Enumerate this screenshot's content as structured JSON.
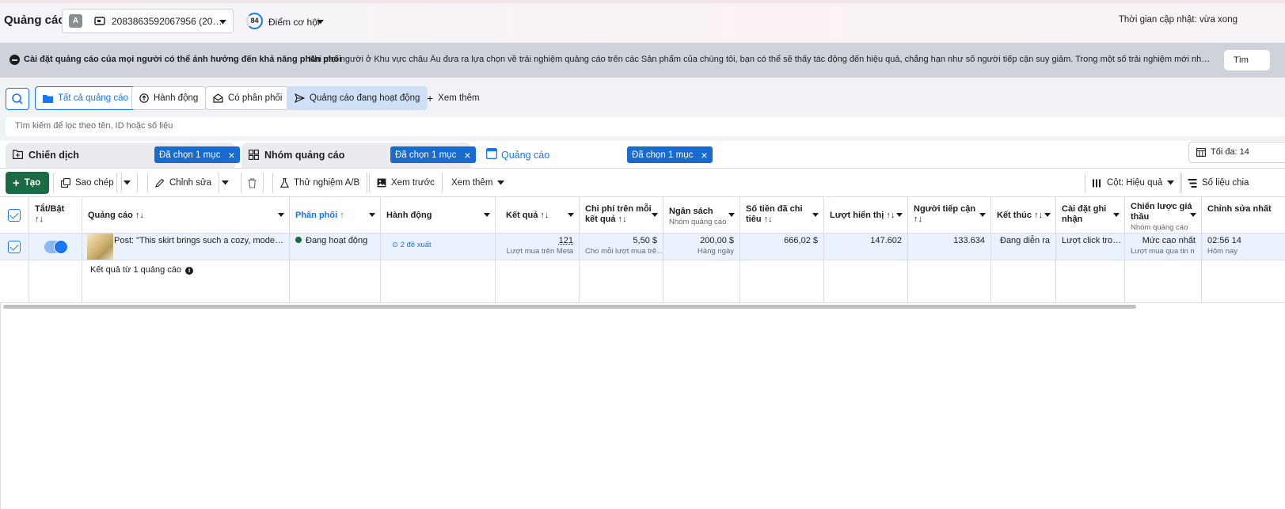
{
  "header": {
    "title": "Quảng cáo",
    "account": {
      "avatar_letter": "A",
      "id": "2083863592067956 (20…"
    },
    "opportunity": {
      "score": "84",
      "label": "Điểm cơ hội"
    },
    "update_time": "Thời gian cập nhật: vừa xong"
  },
  "notice": {
    "title": "Cài đặt quảng cáo của mọi người có thể ảnh hưởng đến khả năng phân phối",
    "text": "Khi mọi người ở Khu vực châu Âu đưa ra lựa chọn về trải nghiệm quảng cáo trên các Sản phẩm của chúng tôi, bạn có thể sẽ thấy tác động đến hiệu quả, chẳng hạn như số người tiếp cận suy giảm. Trong một số trải nghiệm mới như quảng cáo được cá nhân hóa ít hơn...",
    "button": "Tìm"
  },
  "filters": {
    "pills": [
      "Tất cả quảng cáo",
      "Hành động",
      "Có phân phối",
      "Quảng cáo đang hoạt động",
      "Xem thêm"
    ],
    "search_placeholder": "Tìm kiếm để lọc theo tên, ID hoặc số liệu"
  },
  "tabs": [
    {
      "label": "Chiến dịch",
      "chip": "Đã chọn 1 mục"
    },
    {
      "label": "Nhóm quảng cáo",
      "chip": "Đã chọn 1 mục"
    },
    {
      "label": "Quảng cáo",
      "chip": "Đã chọn 1 mục"
    }
  ],
  "period_button": "Tối đa: 14",
  "toolbar": {
    "create": "Tạo",
    "copy": "Sao chép",
    "edit": "Chỉnh sửa",
    "ab_test": "Thử nghiệm A/B",
    "preview": "Xem trước",
    "more": "Xem thêm",
    "columns": "Cột: Hiệu quả",
    "breakdown": "Số liệu chia"
  },
  "table": {
    "headers": {
      "toggle": "Tắt/Bật",
      "ad": "Quảng cáo",
      "delivery": "Phân phối",
      "actions": "Hành động",
      "results": "Kết quả",
      "cpr": "Chi phí trên mỗi kết quả",
      "budget": "Ngân sách",
      "budget_sub": "Nhóm quảng cáo",
      "spent": "Số tiền đã chi tiêu",
      "impressions": "Lượt hiển thị",
      "reach": "Người tiếp cận",
      "ends": "Kết thúc",
      "attribution": "Cài đặt ghi nhận",
      "bid": "Chiến lược giá thầu",
      "bid_sub": "Nhóm quảng cáo",
      "edited": "Chỉnh sửa nhất"
    },
    "row": {
      "ad_name": "Post: \"This skirt brings such a cozy, modern…",
      "delivery": "Đang hoạt động",
      "actions": "2 đề xuất",
      "results": "121",
      "results_sub": "Lượt mua trên Meta",
      "cpr": "5,50 $",
      "cpr_sub": "Cho mỗi lượt mua trê…",
      "budget": "200,00 $",
      "budget_sub": "Hàng ngày",
      "spent": "666,02 $",
      "impressions": "147.602",
      "reach": "133.634",
      "ends": "Đang diễn ra",
      "attribution": "Lượt click tro…",
      "bid": "Mức cao nhất",
      "bid_sub": "Lượt mua qua tin n…",
      "edited": "02:56 14",
      "edited_sub": "Hôm nay"
    },
    "summary": "Kết quả từ 1 quảng cáo"
  },
  "colors": {
    "accent": "#1877f2",
    "create": "#1a6a44",
    "active_dot": "#1a6a44",
    "chip": "#1a6bd0"
  }
}
